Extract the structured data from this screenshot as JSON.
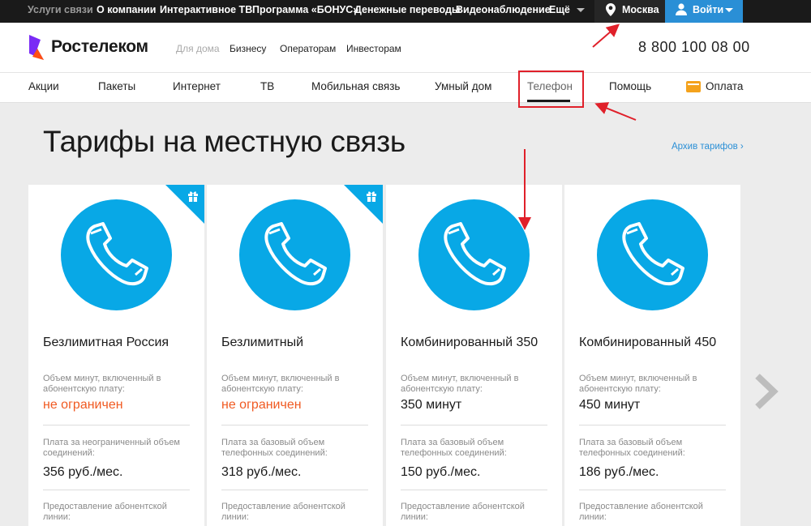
{
  "topbar": {
    "items": [
      "Услуги связи",
      "О компании",
      "Интерактивное ТВ",
      "Программа «БОНУС»",
      "Денежные переводы",
      "Видеонаблюдение",
      "Ещё"
    ],
    "city": "Москва",
    "login": "Войти"
  },
  "header": {
    "brand": "Ростелеком",
    "segments": [
      "Для дома",
      "Бизнесу",
      "Операторам",
      "Инвесторам"
    ],
    "phone": "8 800 100 08 00"
  },
  "nav": {
    "items": [
      "Акции",
      "Пакеты",
      "Интернет",
      "ТВ",
      "Мобильная связь",
      "Умный дом",
      "Телефон",
      "Помощь",
      "Оплата"
    ],
    "active": "Телефон"
  },
  "page": {
    "title": "Тарифы на местную связь",
    "archive_link": "Архив тарифов ›"
  },
  "cards": [
    {
      "name": "Безлимитная Россия",
      "minutes_label": "Объем минут, включенный в абонентскую плату:",
      "minutes_value": "не ограничен",
      "fee_label": "Плата за неограниченный объем соединений:",
      "fee_value": "356 руб./мес.",
      "line_label": "Предоставление абонентской линии:",
      "gift": true
    },
    {
      "name": "Безлимитный",
      "minutes_label": "Объем минут, включенный в абонентскую плату:",
      "minutes_value": "не ограничен",
      "fee_label": "Плата за базовый объем телефонных соединений:",
      "fee_value": "318 руб./мес.",
      "line_label": "Предоставление абонентской линии:",
      "gift": true
    },
    {
      "name": "Комбинированный 350",
      "minutes_label": "Объем минут, включенный в абонентскую плату:",
      "minutes_value": "350 минут",
      "fee_label": "Плата за базовый объем телефонных соединений:",
      "fee_value": "150 руб./мес.",
      "line_label": "Предоставление абонентской линии:",
      "gift": false
    },
    {
      "name": "Комбинированный 450",
      "minutes_label": "Объем минут, включенный в абонентскую плату:",
      "minutes_value": "450 минут",
      "fee_label": "Плата за базовый объем телефонных соединений:",
      "fee_value": "186 руб./мес.",
      "line_label": "Предоставление абонентской линии:",
      "gift": false
    }
  ],
  "colors": {
    "brand_purple": "#7a2bf5",
    "accent_blue": "#08a8e6",
    "orange": "#f05a22",
    "annotation_red": "#e0202a"
  },
  "icons": [
    "location-pin-icon",
    "user-icon",
    "phone-handset-icon",
    "gift-icon",
    "bank-card-icon",
    "chevron-right-icon"
  ]
}
